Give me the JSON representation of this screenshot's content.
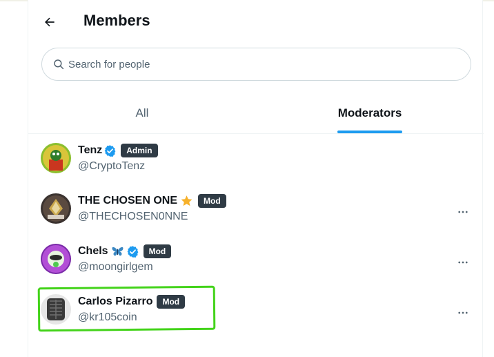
{
  "header": {
    "title": "Members",
    "back_icon": "arrow-left-icon"
  },
  "search": {
    "placeholder": "Search for people",
    "value": "",
    "icon": "search-icon"
  },
  "tabs": [
    {
      "label": "All",
      "active": false
    },
    {
      "label": "Moderators",
      "active": true
    }
  ],
  "colors": {
    "accent": "#1d9bf0",
    "badge_bg": "#2f3b45",
    "highlight": "#43d31a",
    "secondary_text": "#536471"
  },
  "members": [
    {
      "name": "Tenz",
      "handle": "@CryptoTenz",
      "role": "Admin",
      "verified": true,
      "emoji": null,
      "has_menu": false
    },
    {
      "name": "THE CHOSEN ONE",
      "handle": "@THECHOSEN0NNE",
      "role": "Mod",
      "verified": false,
      "emoji": "star",
      "has_menu": true
    },
    {
      "name": "Chels",
      "handle": "@moongirlgem",
      "role": "Mod",
      "verified": true,
      "emoji": "butterfly",
      "has_menu": true
    },
    {
      "name": "Carlos Pizarro",
      "handle": "@kr105coin",
      "role": "Mod",
      "verified": false,
      "emoji": null,
      "has_menu": true,
      "highlighted": true
    }
  ]
}
